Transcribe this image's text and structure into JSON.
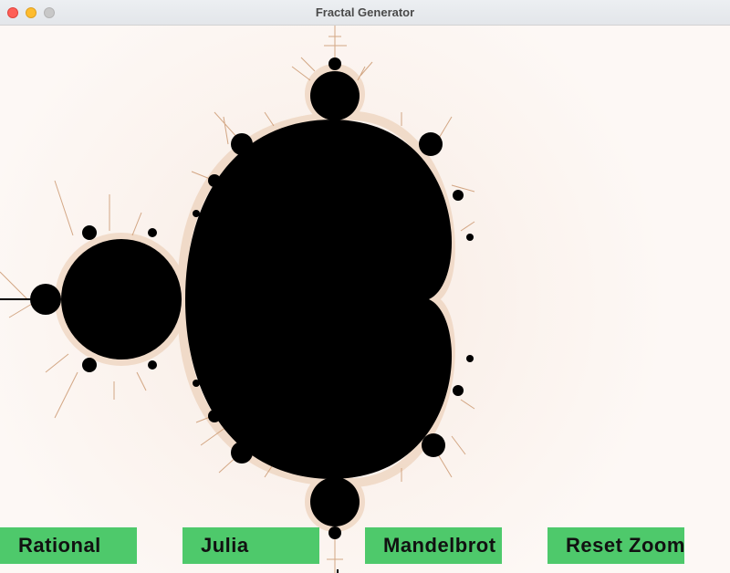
{
  "window": {
    "title": "Fractal Generator"
  },
  "buttons": {
    "rational": "Rational",
    "julia": "Julia",
    "mandelbrot": "Mandelbrot",
    "reset_zoom": "Reset Zoom"
  },
  "colors": {
    "button_bg": "#4ec96b",
    "background": "#fdf8f5",
    "set_fill": "#000000",
    "fringe": "#d8a878"
  },
  "icons": [
    "close-window-icon",
    "minimize-window-icon",
    "maximize-window-icon"
  ]
}
